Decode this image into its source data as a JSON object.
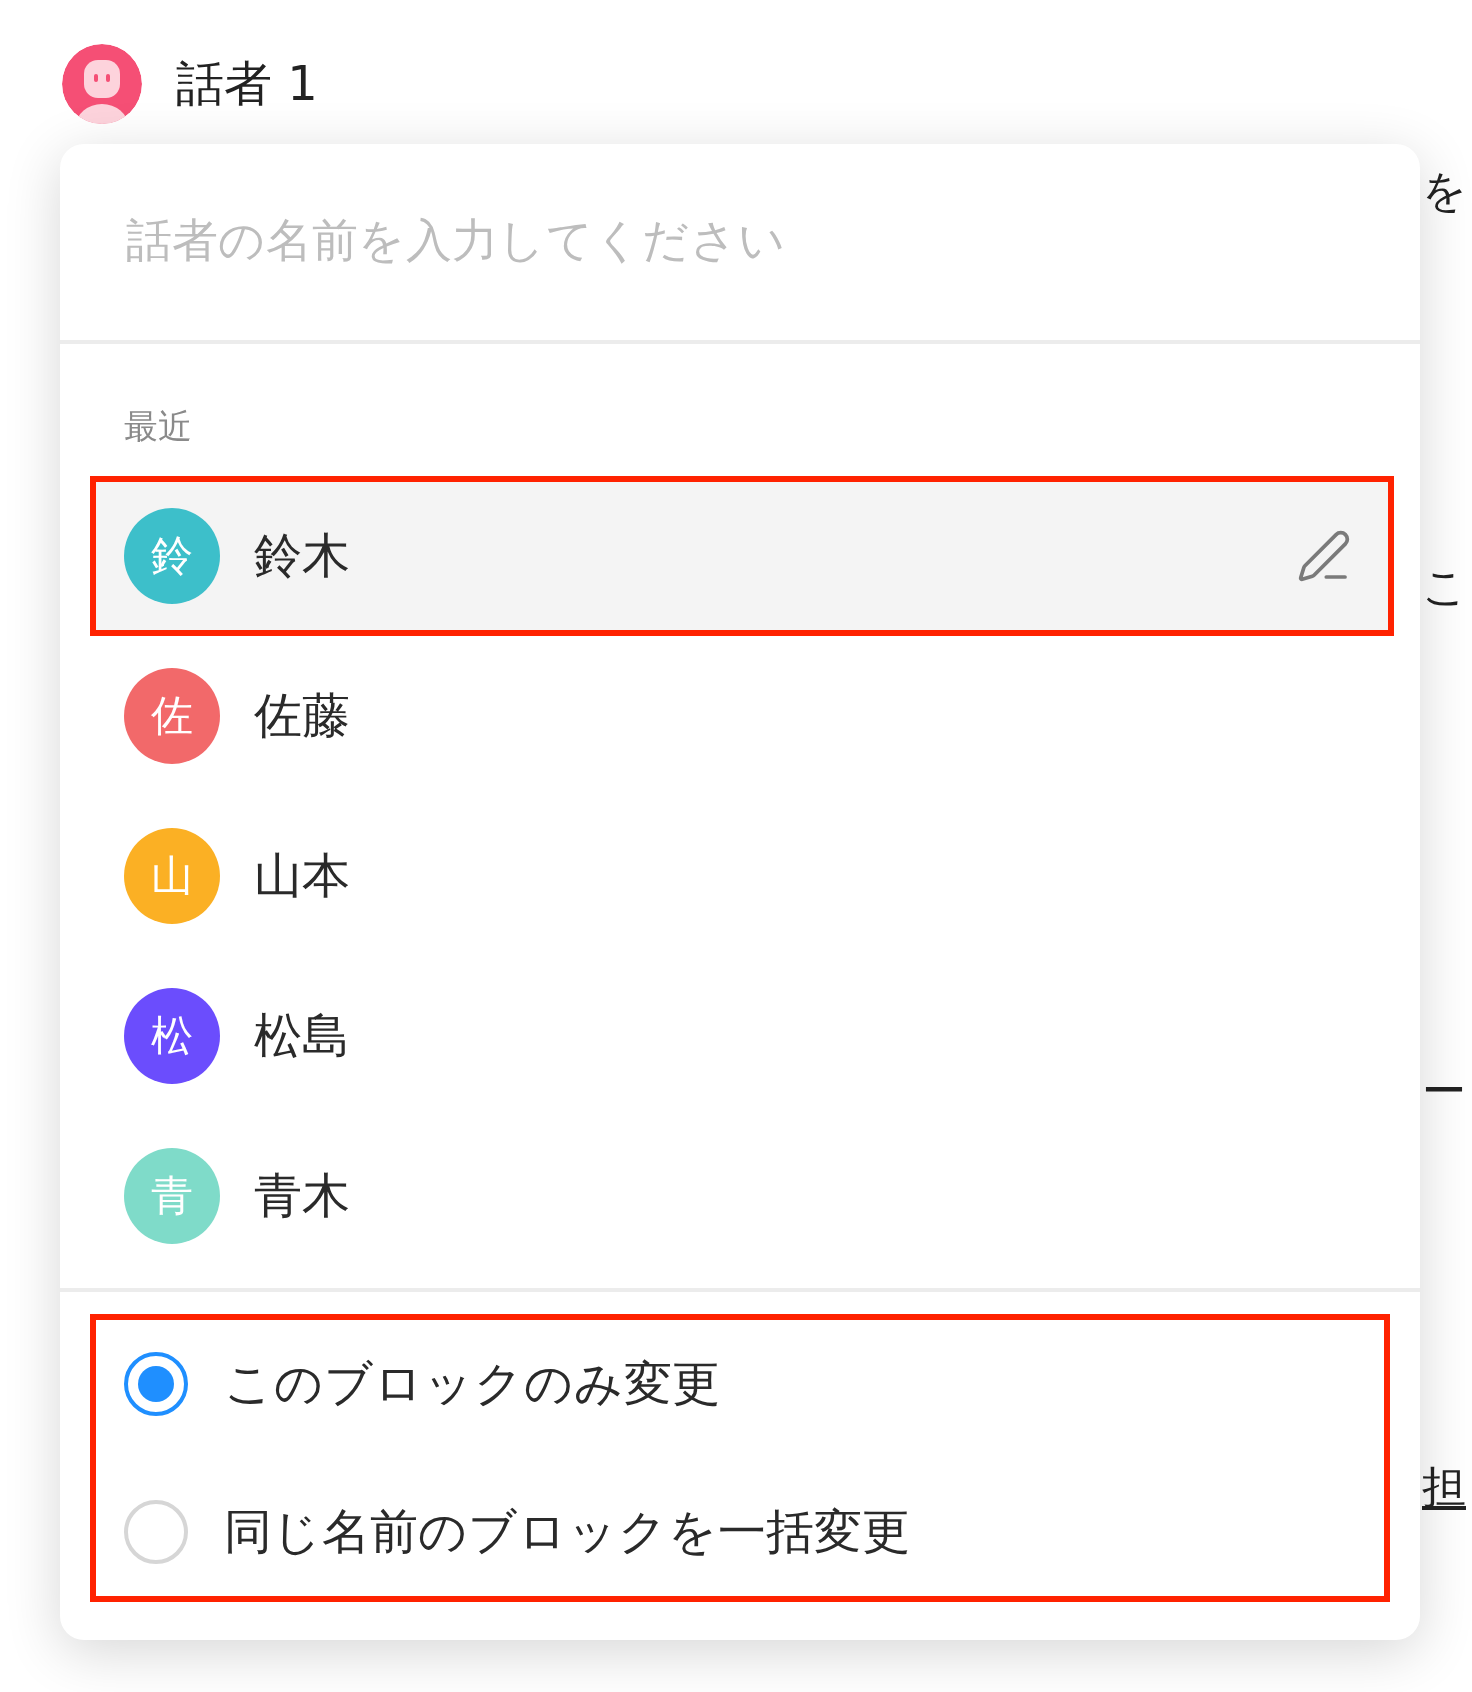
{
  "speaker": {
    "name": "話者 1"
  },
  "background_text": [
    {
      "text": "を",
      "underlined": false
    },
    {
      "text": "こ",
      "underlined": false
    },
    {
      "text": "ー",
      "underlined": false
    },
    {
      "text": "担",
      "underlined": true
    }
  ],
  "popup": {
    "name_input": {
      "placeholder": "話者の名前を入力してください"
    },
    "recent": {
      "label": "最近",
      "items": [
        {
          "initial": "鈴",
          "name": "鈴木",
          "color": "#3dbfca",
          "hovered": true,
          "highlighted": true
        },
        {
          "initial": "佐",
          "name": "佐藤",
          "color": "#f2696a",
          "hovered": false,
          "highlighted": false
        },
        {
          "initial": "山",
          "name": "山本",
          "color": "#fbb024",
          "hovered": false,
          "highlighted": false
        },
        {
          "initial": "松",
          "name": "松島",
          "color": "#6b4dfd",
          "hovered": false,
          "highlighted": false
        },
        {
          "initial": "青",
          "name": "青木",
          "color": "#7fdbc9",
          "hovered": false,
          "highlighted": false
        }
      ]
    },
    "scope": {
      "highlighted": true,
      "options": [
        {
          "label": "このブロックのみ変更",
          "selected": true
        },
        {
          "label": "同じ名前のブロックを一括変更",
          "selected": false
        }
      ]
    }
  }
}
